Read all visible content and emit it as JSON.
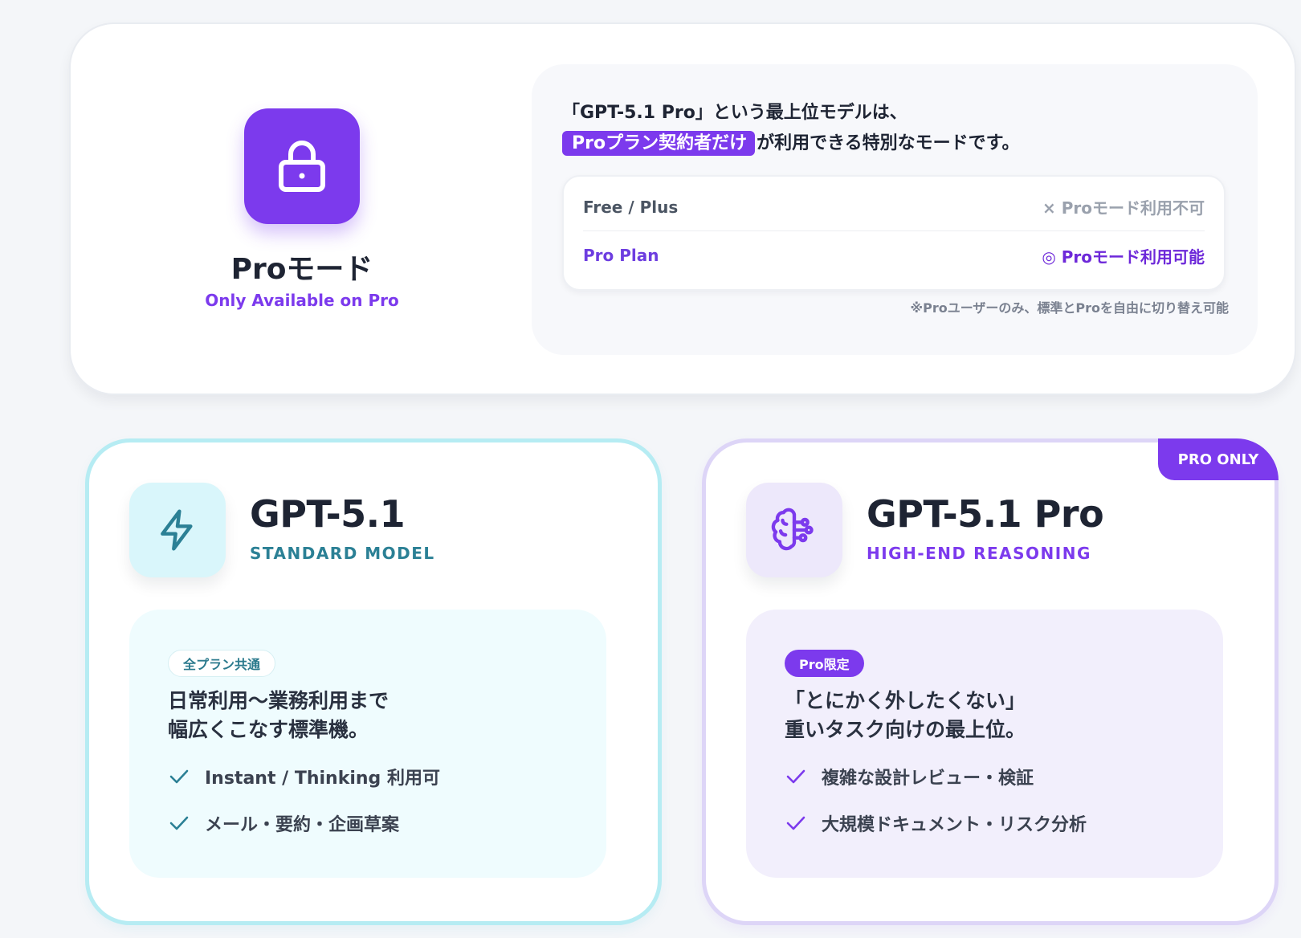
{
  "top": {
    "title": "Proモード",
    "subtitle": "Only Available on Pro",
    "lead_line1": "「GPT-5.1 Pro」という最上位モデルは、",
    "lead_highlight": "Proプラン契約者だけ",
    "lead_line2_rest": "が利用できる特別なモードです。",
    "plans": [
      {
        "name": "Free / Plus",
        "status": "× Proモード利用不可"
      },
      {
        "name": "Pro Plan",
        "status": "◎ Proモード利用可能"
      }
    ],
    "footnote": "※Proユーザーのみ、標準とProを自由に切り替え可能"
  },
  "standard": {
    "icon": "lightning-icon",
    "title": "GPT-5.1",
    "subtitle": "STANDARD MODEL",
    "badge": "全プラン共通",
    "desc_line1": "日常利用〜業務利用まで",
    "desc_line2": "幅広くこなす標準機。",
    "features": [
      "Instant / Thinking 利用可",
      "メール・要約・企画草案"
    ]
  },
  "pro": {
    "icon": "brain-icon",
    "corner_badge": "PRO ONLY",
    "title": "GPT-5.1 Pro",
    "subtitle": "HIGH-END REASONING",
    "badge": "Pro限定",
    "desc_line1": "「とにかく外したくない」",
    "desc_line2": "重いタスク向けの最上位。",
    "features": [
      "複雑な設計レビュー・検証",
      "大規模ドキュメント・リスク分析"
    ]
  },
  "colors": {
    "accent_purple": "#7c3aed",
    "standard_teal": "#2b8095",
    "standard_border": "#b6ecf3",
    "pro_border": "#ddd5f7"
  }
}
